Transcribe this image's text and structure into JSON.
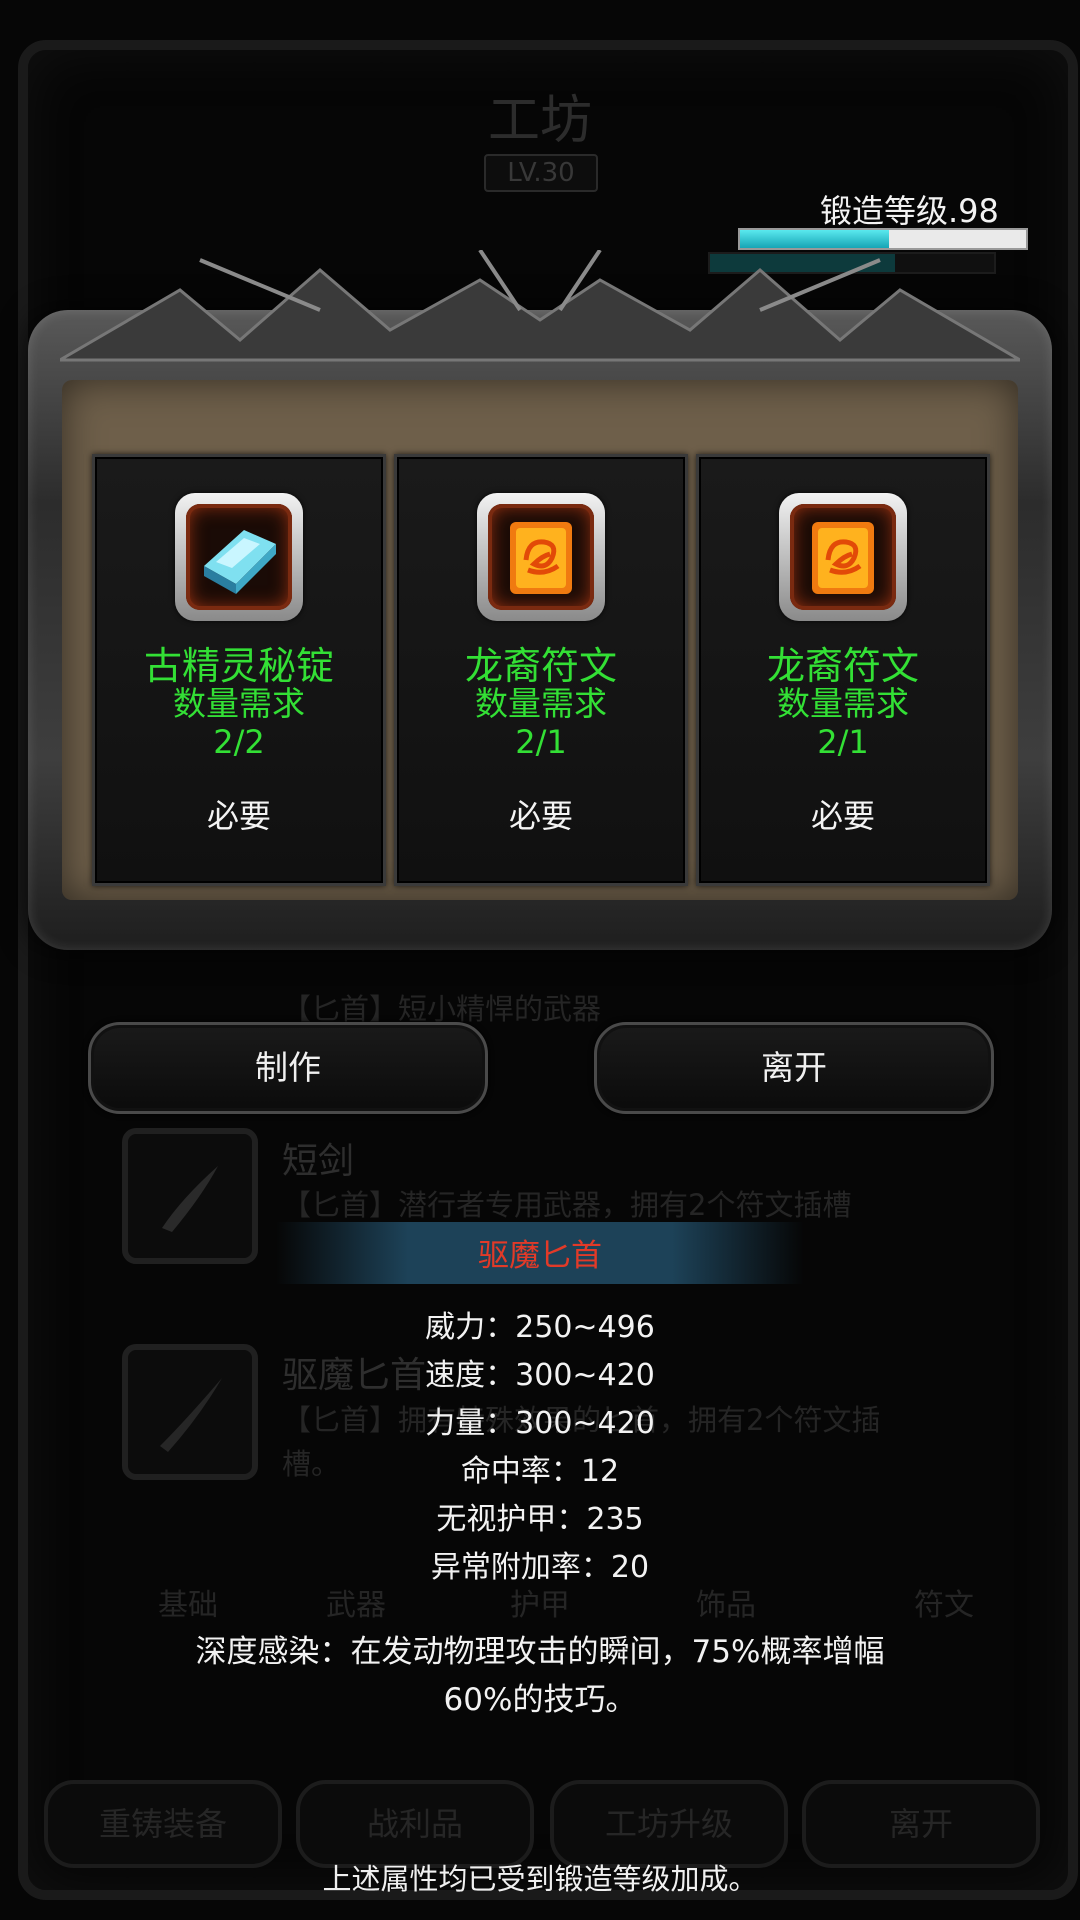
{
  "background": {
    "title": "工坊",
    "level": "LV.30",
    "list": [
      {
        "title": "",
        "desc": "【匕首】短小精悍的武器"
      },
      {
        "title": "短剑",
        "desc": "【匕首】潜行者专用武器，拥有2个符文插槽"
      },
      {
        "title": "驱魔匕首",
        "desc": "【匕首】拥有特殊效果的匕首，拥有2个符文插槽。"
      }
    ],
    "tabs": [
      "基础",
      "武器",
      "护甲",
      "饰品",
      "符文"
    ],
    "buttons": [
      "重铸装备",
      "战利品",
      "工坊升级",
      "离开"
    ]
  },
  "forge": {
    "label": "锻造等级.98",
    "progress": 0.52
  },
  "requirements": [
    {
      "name": "古精灵秘锭",
      "qty_label": "数量需求",
      "qty": "2/2",
      "tag": "必要",
      "icon": "ingot-icon"
    },
    {
      "name": "龙裔符文",
      "qty_label": "数量需求",
      "qty": "2/1",
      "tag": "必要",
      "icon": "rune-icon"
    },
    {
      "name": "龙裔符文",
      "qty_label": "数量需求",
      "qty": "2/1",
      "tag": "必要",
      "icon": "rune-icon"
    }
  ],
  "actions": {
    "craft_label": "制作",
    "leave_label": "离开"
  },
  "item": {
    "name": "驱魔匕首",
    "stats": [
      "威力：250~496",
      "速度：300~420",
      "力量：300~420",
      "命中率：12",
      "无视护甲：235",
      "异常附加率：20"
    ],
    "effect_line1": "深度感染：在发动物理攻击的瞬间，75%概率增幅",
    "effect_line2": "60%的技巧。",
    "footer_note": "上述属性均已受到锻造等级加成。"
  },
  "colors": {
    "accent_green": "#33e035",
    "item_name_red": "#e23a28",
    "progress_cyan": "#2fc8d6"
  }
}
